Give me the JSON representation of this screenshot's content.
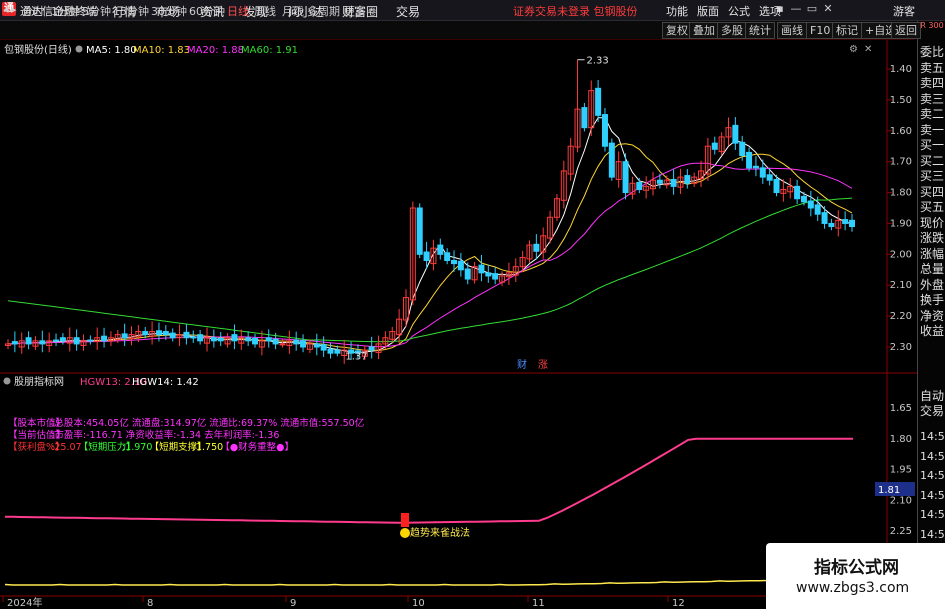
{
  "app": {
    "title": "通达信金融终端",
    "status": "证券交易未登录  包钢股份",
    "guest": "游客"
  },
  "menus": [
    "行情",
    "市场",
    "资讯",
    "发现",
    "问小达",
    "财富圈",
    "交易"
  ],
  "right_menus": [
    "功能",
    "版面",
    "公式",
    "选项"
  ],
  "window_controls": [
    "▪",
    "—",
    "▭",
    "✕"
  ],
  "timeframes": [
    "分时",
    "1分钟",
    "5分钟",
    "15分钟",
    "30分钟",
    "60分钟",
    "日线",
    "周线",
    "月线",
    "多周期",
    "更多"
  ],
  "active_timeframe": "日线",
  "tool_buttons": [
    "复权",
    "叠加",
    "多股",
    "统计",
    "画线",
    "F10",
    "标记",
    "+自选",
    "返回"
  ],
  "side_items": [
    "委比",
    "卖五",
    "卖四",
    "卖三",
    "卖二",
    "卖一",
    "买一",
    "买二",
    "买三",
    "买四",
    "买五",
    "现价",
    "涨跌",
    "涨幅",
    "总量",
    "外盘",
    "换手",
    "净资",
    "收益",
    "自动",
    "交易",
    "14:56",
    "14:56",
    "14:56",
    "14:56",
    "14:56",
    "14:56",
    "14:56",
    "14:56"
  ],
  "side_badge": "R 300",
  "main_panel": {
    "stock": "包钢股份(日线)",
    "ma_legend": [
      {
        "label": "MA5: 1.80",
        "color": "#ffffff"
      },
      {
        "label": "MA10: 1.83",
        "color": "#ffd633"
      },
      {
        "label": "MA20: 1.88",
        "color": "#ff33ff"
      },
      {
        "label": "MA60: 1.91",
        "color": "#33dd33"
      }
    ],
    "high_label": "2.33",
    "low_label": "1.37",
    "markers": [
      {
        "text": "财",
        "color": "#4d8cff"
      },
      {
        "text": "涨",
        "color": "#ff4040"
      }
    ],
    "y_ticks": [
      "2.30",
      "2.20",
      "2.10",
      "2.00",
      "1.90",
      "1.80",
      "1.70",
      "1.60",
      "1.50",
      "1.40"
    ]
  },
  "indicator_panel": {
    "name": "股朋指标网",
    "hgw_legend": [
      {
        "label": "HGW13: 2.10",
        "color": "#ff3b8e"
      },
      {
        "label": "HGW14: 1.42",
        "color": "#ffffff"
      }
    ],
    "info_lines": [
      [
        {
          "t": "【股本市值】",
          "c": "#ff33ff"
        },
        {
          "t": ":总股本:454.05亿 流通盘:314.97亿 流通比:69.37% 流通市值:557.50亿",
          "c": "#ff33ff"
        }
      ],
      [
        {
          "t": "【当前估值】",
          "c": "#ff33ff"
        },
        {
          "t": ":市盈率:-116.71 净资收益率:-1.34 去年利润率:-1.36",
          "c": "#ff33ff"
        }
      ],
      [
        {
          "t": "【获利盘%】",
          "c": "#ff3333"
        },
        {
          "t": ":25.07",
          "c": "#ff3333"
        },
        {
          "t": "【短期压力】",
          "c": "#33ff33"
        },
        {
          "t": ":1.970",
          "c": "#33ff33"
        },
        {
          "t": "【短期支撑】",
          "c": "#ffff33"
        },
        {
          "t": ":1.750",
          "c": "#ffff33"
        },
        {
          "t": "【●财务重整●】",
          "c": "#ff33ff"
        }
      ]
    ],
    "signal_text": "趋势来雀战法",
    "price_tag": "1.81",
    "y_ticks": [
      "2.25",
      "2.10",
      "1.95",
      "1.80",
      "1.65"
    ]
  },
  "x_labels": [
    "2024年",
    "8",
    "9",
    "10",
    "11",
    "12"
  ],
  "watermark": {
    "line1": "指标公式网",
    "line2": "www.zbgs3.com"
  },
  "chart_data": {
    "type": "candlestick",
    "series_name": "包钢股份(日线)",
    "ylim": [
      1.35,
      2.35
    ],
    "y_ticks": [
      1.4,
      1.5,
      1.6,
      1.7,
      1.8,
      1.9,
      2.0,
      2.1,
      2.2,
      2.3
    ],
    "x_ticks": [
      "2024年",
      "8",
      "9",
      "10",
      "11",
      "12"
    ],
    "closes": [
      1.41,
      1.41,
      1.42,
      1.41,
      1.42,
      1.41,
      1.42,
      1.42,
      1.42,
      1.43,
      1.41,
      1.42,
      1.42,
      1.43,
      1.42,
      1.43,
      1.44,
      1.43,
      1.44,
      1.45,
      1.44,
      1.45,
      1.44,
      1.44,
      1.43,
      1.44,
      1.43,
      1.43,
      1.42,
      1.43,
      1.42,
      1.42,
      1.43,
      1.42,
      1.43,
      1.42,
      1.41,
      1.42,
      1.42,
      1.41,
      1.41,
      1.42,
      1.41,
      1.4,
      1.41,
      1.4,
      1.39,
      1.38,
      1.38,
      1.39,
      1.38,
      1.38,
      1.39,
      1.39,
      1.41,
      1.43,
      1.45,
      1.49,
      1.56,
      1.85,
      1.7,
      1.68,
      1.72,
      1.7,
      1.68,
      1.67,
      1.65,
      1.62,
      1.66,
      1.64,
      1.63,
      1.62,
      1.63,
      1.64,
      1.66,
      1.69,
      1.73,
      1.71,
      1.76,
      1.82,
      1.88,
      1.97,
      2.05,
      2.17,
      2.11,
      2.23,
      2.15,
      2.05,
      1.95,
      2.0,
      1.9,
      1.93,
      1.91,
      1.92,
      1.94,
      1.93,
      1.94,
      1.92,
      1.95,
      1.93,
      1.95,
      1.97,
      2.05,
      2.04,
      2.08,
      2.11,
      2.06,
      2.02,
      1.98,
      1.98,
      1.95,
      1.94,
      1.9,
      1.91,
      1.92,
      1.88,
      1.87,
      1.85,
      1.83,
      1.8,
      1.79,
      1.81,
      1.8,
      1.79
    ],
    "ma": [
      {
        "name": "MA5",
        "color": "#ffffff",
        "value": 1.8
      },
      {
        "name": "MA10",
        "color": "#ffd633",
        "value": 1.83
      },
      {
        "name": "MA20",
        "color": "#ff33ff",
        "value": 1.88
      },
      {
        "name": "MA60",
        "color": "#33dd33",
        "value": 1.91
      }
    ],
    "high": 2.33,
    "low": 1.37,
    "indicator": {
      "ylim": [
        1.6,
        2.3
      ],
      "y_ticks": [
        1.65,
        1.8,
        1.95,
        2.1,
        2.25
      ],
      "hgw13": {
        "name": "HGW13",
        "color": "#ff3b8e",
        "last": 2.1
      },
      "hgw14": {
        "name": "HGW14",
        "color": "#ffffff",
        "last": 1.42
      }
    }
  }
}
